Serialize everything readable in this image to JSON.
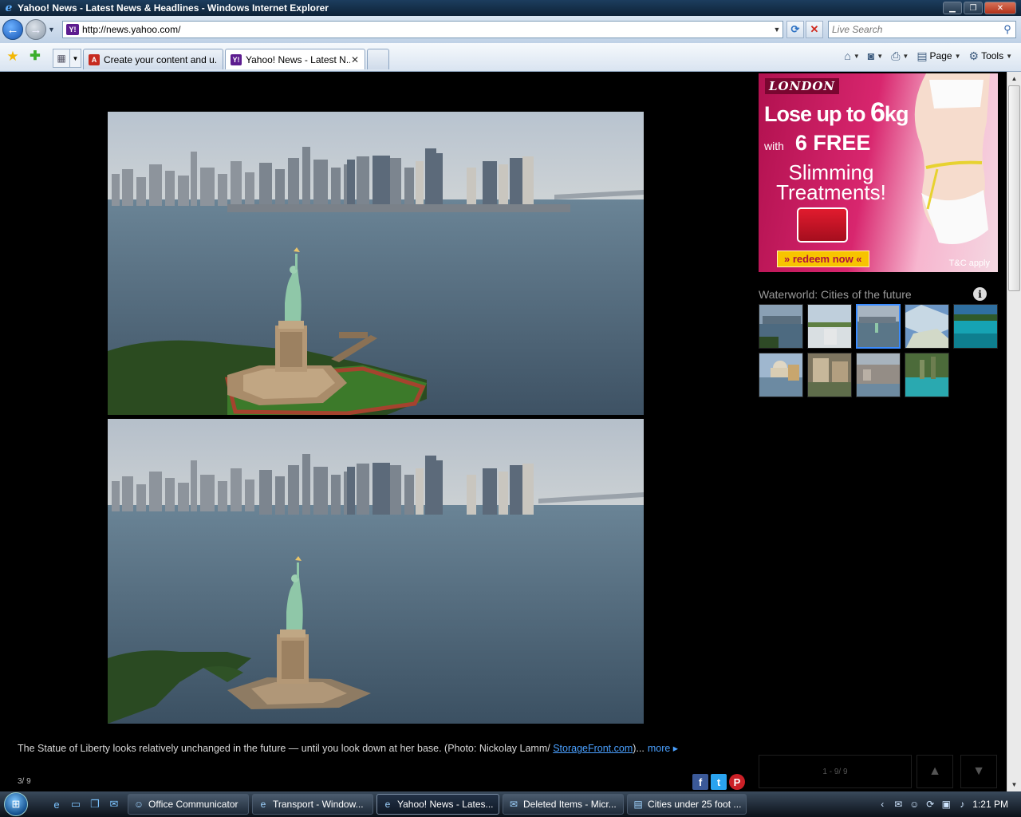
{
  "window": {
    "title": "Yahoo! News - Latest News & Headlines - Windows Internet Explorer",
    "min": "▁",
    "max": "❐",
    "close": "✕"
  },
  "nav": {
    "url": "http://news.yahoo.com/",
    "search_placeholder": "Live Search"
  },
  "tabs": [
    {
      "label": "Create your content and u..."
    },
    {
      "label": "Yahoo! News - Latest N..."
    }
  ],
  "commands": {
    "page": "Page",
    "tools": "Tools"
  },
  "ad": {
    "brand": "LONDON",
    "line1a": "Lose up to ",
    "line1b": "6",
    "line1c": "kg",
    "line2a": "with",
    "line2b": "6 FREE",
    "line3": "Slimming Treatments!",
    "cta": "» redeem now «",
    "terms": "T&C apply"
  },
  "gallery": {
    "title": "Waterworld: Cities of the future",
    "pager": "1 - 9/ 9"
  },
  "caption": {
    "text": "The Statue of Liberty looks relatively unchanged in the future — until you look down at her base. (Photo: Nickolay Lamm/ ",
    "link": "StorageFront.com",
    "after": ")...",
    "more": "more ▸",
    "counter": "3/ 9"
  },
  "taskbar": {
    "items": [
      {
        "label": "Office Communicator"
      },
      {
        "label": "Transport - Window..."
      },
      {
        "label": "Yahoo! News - Lates..."
      },
      {
        "label": "Deleted Items - Micr..."
      },
      {
        "label": "Cities under 25 foot ..."
      }
    ],
    "clock": "1:21 PM"
  }
}
